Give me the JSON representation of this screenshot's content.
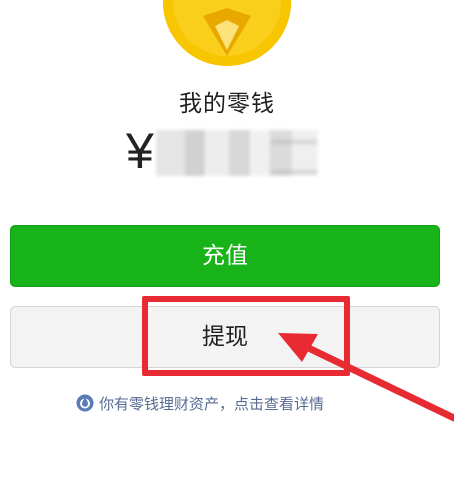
{
  "wallet": {
    "title": "我的零钱",
    "currency_symbol": "¥"
  },
  "actions": {
    "recharge_label": "充值",
    "withdraw_label": "提现"
  },
  "finance_link": {
    "text": "你有零钱理财资产，点击查看详情"
  },
  "icons": {
    "coin": "gold-coin-icon",
    "finance": "fund-drop-icon"
  },
  "colors": {
    "coin": "#f7c600",
    "primary_button": "#18b318",
    "secondary_button": "#f3f3f3",
    "link": "#576b95",
    "annotation": "#e82a32"
  }
}
